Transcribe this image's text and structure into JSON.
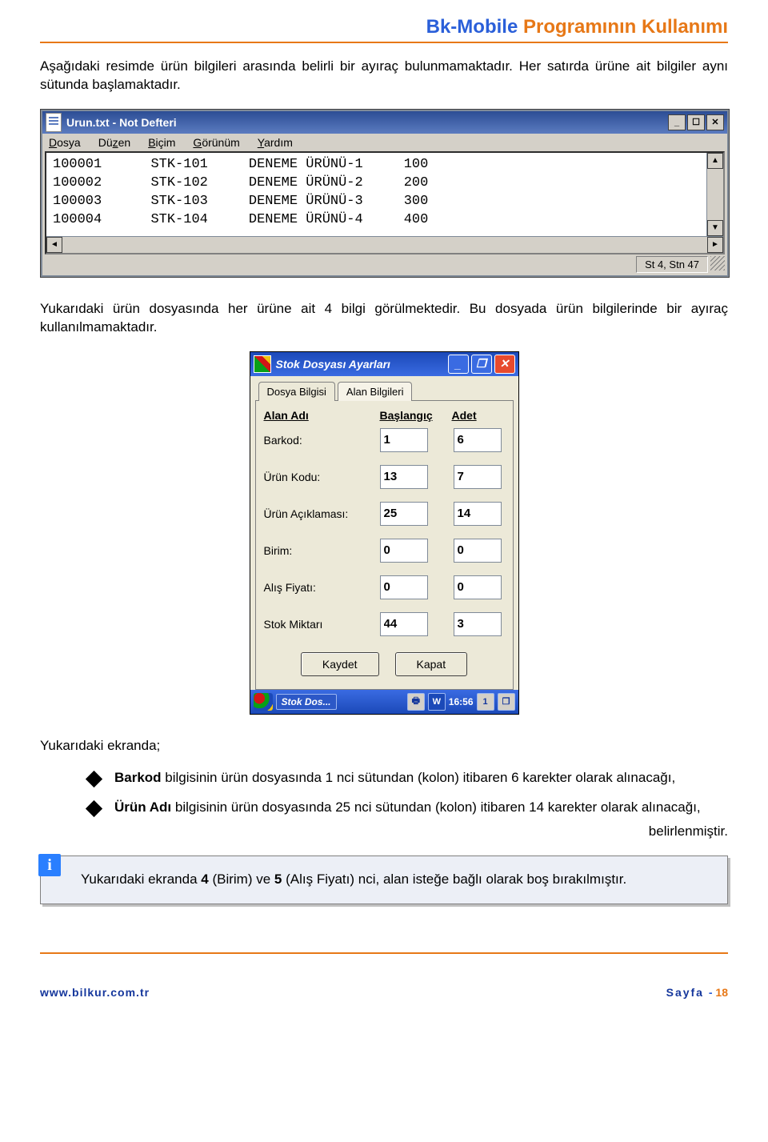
{
  "header": {
    "blue": "Bk-Mobile",
    "orange": " Programının Kullanımı"
  },
  "para1": "Aşağıdaki resimde ürün bilgileri arasında belirli bir ayıraç bulunmamaktadır. Her satırda ürüne ait bilgiler aynı sütunda başlamaktadır.",
  "notepad": {
    "title": "Urun.txt - Not Defteri",
    "menus": {
      "dosya": "Dosya",
      "duzen": "Düzen",
      "bicim": "Biçim",
      "gorunum": "Görünüm",
      "yardim": "Yardım"
    },
    "rows": [
      {
        "c1": "100001",
        "c2": "STK-101",
        "c3": "DENEME ÜRÜNÜ-1",
        "c4": "100"
      },
      {
        "c1": "100002",
        "c2": "STK-102",
        "c3": "DENEME ÜRÜNÜ-2",
        "c4": "200"
      },
      {
        "c1": "100003",
        "c2": "STK-103",
        "c3": "DENEME ÜRÜNÜ-3",
        "c4": "300"
      },
      {
        "c1": "100004",
        "c2": "STK-104",
        "c3": "DENEME ÜRÜNÜ-4",
        "c4": "400"
      }
    ],
    "status": "St 4, Stn 47"
  },
  "para2": "Yukarıdaki ürün dosyasında her ürüne ait 4 bilgi görülmektedir. Bu dosyada ürün bilgilerinde bir ayıraç kullanılmamaktadır.",
  "dialog": {
    "title": "Stok Dosyası Ayarları",
    "tabs": {
      "t1": "Dosya Bilgisi",
      "t2": "Alan Bilgileri"
    },
    "cols": {
      "c1": "Alan Adı",
      "c2": "Başlangıç",
      "c3": "Adet"
    },
    "fields": [
      {
        "label": "Barkod:",
        "start": "1",
        "count": "6"
      },
      {
        "label": "Ürün Kodu:",
        "start": "13",
        "count": "7"
      },
      {
        "label": "Ürün Açıklaması:",
        "start": "25",
        "count": "14"
      },
      {
        "label": "Birim:",
        "start": "0",
        "count": "0"
      },
      {
        "label": "Alış Fiyatı:",
        "start": "0",
        "count": "0"
      },
      {
        "label": "Stok Miktarı",
        "start": "44",
        "count": "3"
      }
    ],
    "buttons": {
      "save": "Kaydet",
      "close": "Kapat"
    },
    "task": "Stok Dos...",
    "clock": "16:56",
    "tray1": "1",
    "trayW": "W"
  },
  "para3": "Yukarıdaki ekranda;",
  "bullets": [
    {
      "bold": "Barkod",
      "text": " bilgisinin ürün dosyasında 1 nci sütundan (kolon) itibaren 6 karekter olarak alınacağı,"
    },
    {
      "bold": "Ürün Adı",
      "text": " bilgisinin ürün dosyasında 25 nci sütundan (kolon) itibaren 14 karekter olarak alınacağı,"
    }
  ],
  "rightword": "belirlenmiştir.",
  "callout_pre": "Yukarıdaki ekranda ",
  "callout_b1": "4",
  "callout_mid1": " (Birim) ve ",
  "callout_b2": "5",
  "callout_mid2": " (Alış Fiyatı) nci, alan isteğe bağlı olarak boş bırakılmıştır.",
  "footer": {
    "url": "www.bilkur.com.tr",
    "pagelabel": "Sayfa ",
    "dash": "- ",
    "num": "18"
  }
}
